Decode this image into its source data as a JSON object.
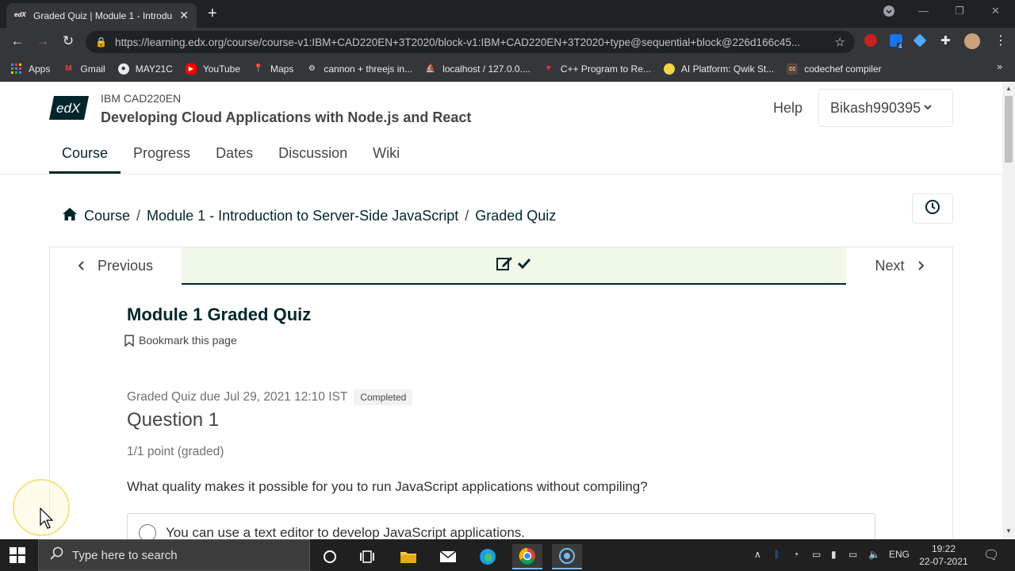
{
  "browser": {
    "tab_title": "Graded Quiz | Module 1 - Introdu",
    "tab_favicon": "edX",
    "url": "https://learning.edx.org/course/course-v1:IBM+CAD220EN+3T2020/block-v1:IBM+CAD220EN+3T2020+type@sequential+block@226d166c45...",
    "bookmarks": [
      {
        "label": "Apps",
        "icon": "apps-grid-icon"
      },
      {
        "label": "Gmail",
        "icon": "gmail-icon"
      },
      {
        "label": "MAY21C",
        "icon": "globe-icon"
      },
      {
        "label": "YouTube",
        "icon": "youtube-icon"
      },
      {
        "label": "Maps",
        "icon": "maps-icon"
      },
      {
        "label": "cannon + threejs in...",
        "icon": "cannon-icon"
      },
      {
        "label": "localhost / 127.0.0....",
        "icon": "phpmyadmin-icon"
      },
      {
        "label": "C++ Program to Re...",
        "icon": "bookmark-red-icon"
      },
      {
        "label": "AI Platform: Qwik St...",
        "icon": "qwiklabs-icon"
      },
      {
        "label": "codechef compiler",
        "icon": "codechef-icon"
      }
    ],
    "extension_badge": "4"
  },
  "header": {
    "logo_text": "edX",
    "course_org": "IBM CAD220EN",
    "course_name": "Developing Cloud Applications with Node.js and React",
    "help": "Help",
    "username": "Bikash990395"
  },
  "course_tabs": [
    "Course",
    "Progress",
    "Dates",
    "Discussion",
    "Wiki"
  ],
  "breadcrumb": {
    "course": "Course",
    "module": "Module 1 - Introduction to Server-Side JavaScript",
    "current": "Graded Quiz",
    "separator": "/"
  },
  "sequence_nav": {
    "previous": "Previous",
    "next": "Next"
  },
  "unit": {
    "title": "Module 1 Graded Quiz",
    "bookmark": "Bookmark this page",
    "due": "Graded Quiz due Jul 29, 2021 12:10 IST",
    "status": "Completed",
    "question_title": "Question 1",
    "points": "1/1 point (graded)",
    "question_text": "What quality makes it possible for you to run JavaScript applications without compiling?",
    "choices": [
      "You can use a text editor to develop JavaScript applications."
    ]
  },
  "taskbar": {
    "search_placeholder": "Type here to search",
    "language": "ENG",
    "time": "19:22",
    "date": "22-07-2021"
  },
  "colors": {
    "primary": "#00262b",
    "unit_highlight": "#f0f8e9",
    "chrome_dark": "#202124"
  }
}
